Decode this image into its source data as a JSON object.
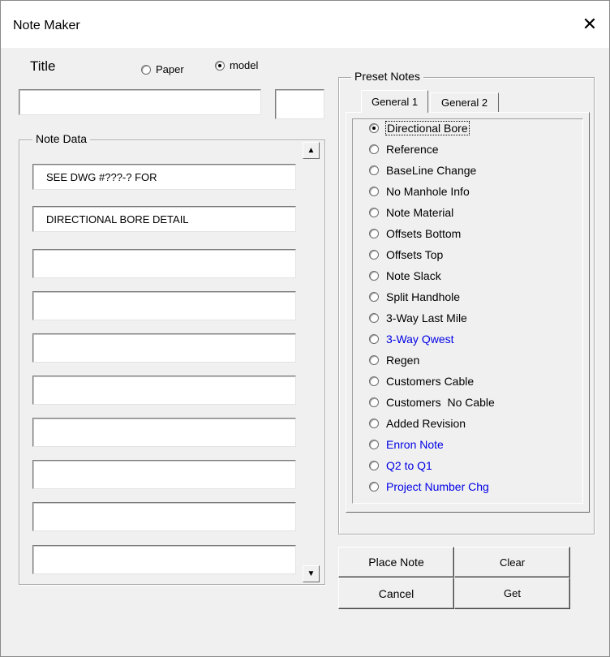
{
  "window": {
    "title": "Note Maker",
    "close_symbol": "✕"
  },
  "title_section": {
    "label": "Title",
    "mode_options": [
      {
        "label": "Paper",
        "checked": false
      },
      {
        "label": "model",
        "checked": true
      }
    ],
    "title_value": "",
    "number_value": ""
  },
  "note_data": {
    "legend": "Note Data",
    "lines": [
      "SEE DWG #???-? FOR",
      "DIRECTIONAL BORE DETAIL",
      "",
      "",
      "",
      "",
      "",
      "",
      "",
      ""
    ],
    "scroll_up": "▲",
    "scroll_down": "▼"
  },
  "preset_notes": {
    "legend": "Preset Notes",
    "tabs": [
      "General 1",
      "General 2"
    ],
    "active_tab": "General 1",
    "items": [
      {
        "label": "Directional Bore",
        "checked": true,
        "blue": false
      },
      {
        "label": "Reference",
        "checked": false,
        "blue": false
      },
      {
        "label": "BaseLine Change",
        "checked": false,
        "blue": false
      },
      {
        "label": "No Manhole Info",
        "checked": false,
        "blue": false
      },
      {
        "label": "Note Material",
        "checked": false,
        "blue": false
      },
      {
        "label": "Offsets Bottom",
        "checked": false,
        "blue": false
      },
      {
        "label": "Offsets Top",
        "checked": false,
        "blue": false
      },
      {
        "label": "Note Slack",
        "checked": false,
        "blue": false
      },
      {
        "label": "Split Handhole",
        "checked": false,
        "blue": false
      },
      {
        "label": "3-Way Last Mile",
        "checked": false,
        "blue": false
      },
      {
        "label": "3-Way Qwest",
        "checked": false,
        "blue": true
      },
      {
        "label": "Regen",
        "checked": false,
        "blue": false
      },
      {
        "label": "Customers Cable",
        "checked": false,
        "blue": false
      },
      {
        "label": "Customers  No Cable",
        "checked": false,
        "blue": false
      },
      {
        "label": "Added Revision",
        "checked": false,
        "blue": false
      },
      {
        "label": "Enron Note",
        "checked": false,
        "blue": true
      },
      {
        "label": "Q2 to Q1",
        "checked": false,
        "blue": true
      },
      {
        "label": "Project Number Chg",
        "checked": false,
        "blue": true
      }
    ]
  },
  "buttons": {
    "place_note": "Place Note",
    "clear": "Clear",
    "cancel": "Cancel",
    "get": "Get"
  },
  "colors": {
    "link_blue": "#0000e6",
    "background": "#f0f0f0"
  }
}
